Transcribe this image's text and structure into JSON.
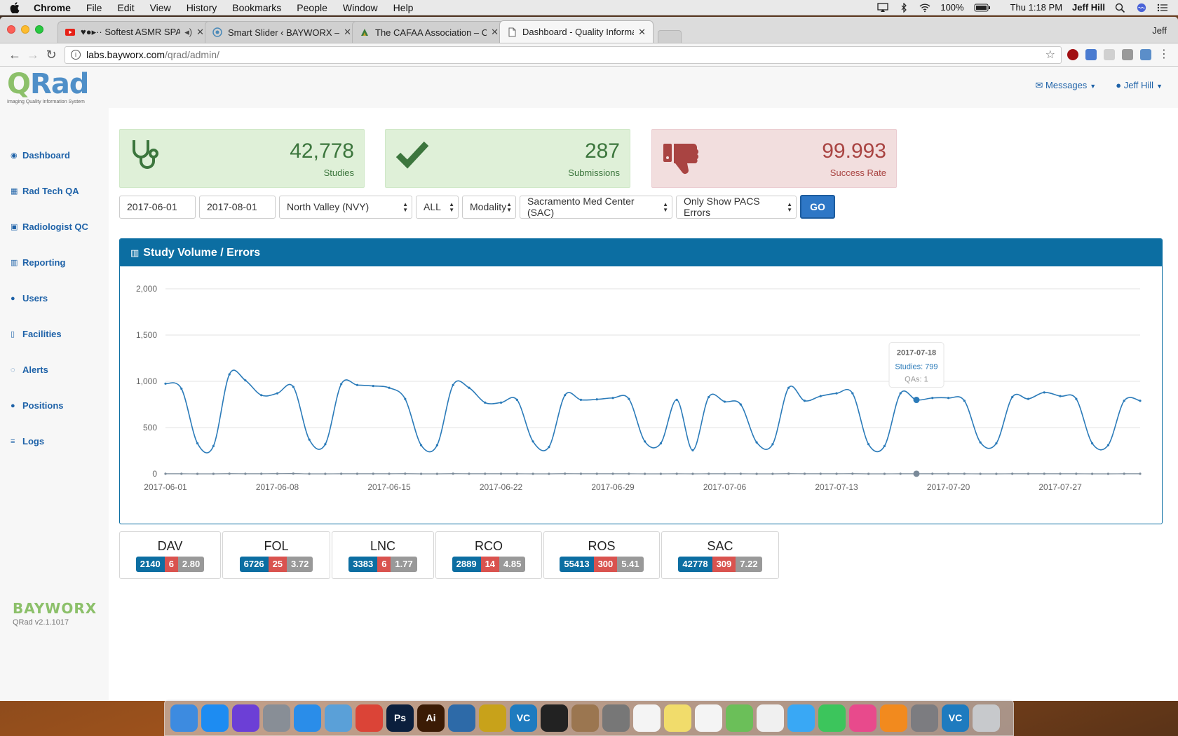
{
  "menubar": {
    "app": "Chrome",
    "items": [
      "File",
      "Edit",
      "View",
      "History",
      "Bookmarks",
      "People",
      "Window",
      "Help"
    ],
    "battery": "100%",
    "clock": "Thu 1:18 PM",
    "user": "Jeff Hill"
  },
  "browser": {
    "tabs": [
      {
        "title": "♥●▸·· Softest ASMR SPA 💤",
        "favicon": "youtube-icon"
      },
      {
        "title": "Smart Slider ‹ BAYWORX — WordPress",
        "favicon": "wordpress-icon"
      },
      {
        "title": "The CAFAA Association – California",
        "favicon": "site-icon"
      },
      {
        "title": "Dashboard - Quality Information System",
        "favicon": "page-icon"
      }
    ],
    "profile": "Jeff",
    "url_host": "labs.bayworx.com",
    "url_path": "/qrad/admin/"
  },
  "app": {
    "logo": "QRad",
    "tagline": "Imaging Quality Information System",
    "nav": [
      {
        "label": "Dashboard",
        "icon": "dashboard-icon",
        "glyph": "◉"
      },
      {
        "label": "Rad Tech QA",
        "icon": "table-icon",
        "glyph": "▦"
      },
      {
        "label": "Radiologist QC",
        "icon": "image-icon",
        "glyph": "▣"
      },
      {
        "label": "Reporting",
        "icon": "bar-chart-icon",
        "glyph": "▥"
      },
      {
        "label": "Users",
        "icon": "user-icon",
        "glyph": "●"
      },
      {
        "label": "Facilities",
        "icon": "clipboard-icon",
        "glyph": "▯"
      },
      {
        "label": "Alerts",
        "icon": "comment-icon",
        "glyph": "◌"
      },
      {
        "label": "Positions",
        "icon": "users-icon",
        "glyph": "●"
      },
      {
        "label": "Logs",
        "icon": "list-icon",
        "glyph": "≡"
      }
    ],
    "brand": "BAYWORX",
    "version": "QRad v2.1.1017",
    "messages_label": "Messages",
    "user_label": "Jeff Hill"
  },
  "stats": [
    {
      "value": "42,778",
      "label": "Studies",
      "icon": "stethoscope-icon"
    },
    {
      "value": "287",
      "label": "Submissions",
      "icon": "checkmark-icon"
    },
    {
      "value": "99.993",
      "label": "Success Rate",
      "icon": "thumbs-down-icon"
    }
  ],
  "filters": {
    "start_date": "2017-06-01",
    "end_date": "2017-08-01",
    "region": "North Valley (NVY)",
    "scope": "ALL",
    "modality": "Modality",
    "facility": "Sacramento Med Center (SAC)",
    "error_filter": "Only Show PACS Errors",
    "go_label": "GO"
  },
  "panel_title": "Study Volume / Errors",
  "chart_data": {
    "type": "line",
    "title": "Study Volume / Errors",
    "ylim": [
      0,
      2000
    ],
    "yticks": [
      "0",
      "500",
      "1,000",
      "1,500",
      "2,000"
    ],
    "xticks": [
      "2017-06-01",
      "2017-06-08",
      "2017-06-15",
      "2017-06-22",
      "2017-06-29",
      "2017-07-06",
      "2017-07-13",
      "2017-07-20",
      "2017-07-27"
    ],
    "x_start": "2017-06-01",
    "x_end": "2017-07-31",
    "grid": true,
    "series": [
      {
        "name": "Studies",
        "values": [
          975,
          920,
          330,
          300,
          1075,
          1010,
          850,
          870,
          940,
          370,
          320,
          970,
          960,
          950,
          930,
          810,
          310,
          310,
          960,
          930,
          770,
          770,
          800,
          350,
          290,
          850,
          800,
          805,
          820,
          810,
          350,
          330,
          800,
          255,
          830,
          780,
          750,
          340,
          320,
          930,
          790,
          840,
          870,
          870,
          320,
          300,
          870,
          799,
          820,
          820,
          790,
          340,
          330,
          830,
          810,
          880,
          840,
          810,
          330,
          310,
          790,
          790
        ]
      },
      {
        "name": "QAs",
        "values": [
          1,
          1,
          0,
          0,
          2,
          1,
          1,
          2,
          3,
          0,
          0,
          1,
          1,
          1,
          1,
          2,
          0,
          0,
          2,
          1,
          1,
          1,
          1,
          0,
          0,
          2,
          1,
          1,
          1,
          1,
          0,
          0,
          1,
          0,
          1,
          1,
          1,
          0,
          0,
          2,
          1,
          1,
          1,
          2,
          0,
          0,
          1,
          1,
          1,
          1,
          1,
          0,
          0,
          1,
          1,
          1,
          1,
          1,
          0,
          0,
          1,
          1
        ]
      }
    ],
    "tooltip": {
      "date": "2017-07-18",
      "studies": "Studies: 799",
      "qas": "QAs: 1",
      "index": 47
    },
    "colors": {
      "studies": "#2b7bb9",
      "qas": "#7a8a99"
    }
  },
  "facilities": [
    {
      "code": "DAV",
      "total": "2140",
      "errors": "6",
      "rate": "2.80"
    },
    {
      "code": "FOL",
      "total": "6726",
      "errors": "25",
      "rate": "3.72"
    },
    {
      "code": "LNC",
      "total": "3383",
      "errors": "6",
      "rate": "1.77"
    },
    {
      "code": "RCO",
      "total": "2889",
      "errors": "14",
      "rate": "4.85"
    },
    {
      "code": "ROS",
      "total": "55413",
      "errors": "300",
      "rate": "5.41"
    },
    {
      "code": "SAC",
      "total": "42778",
      "errors": "309",
      "rate": "7.22"
    }
  ],
  "dock": [
    {
      "name": "finder-icon",
      "color": "#3d8be0"
    },
    {
      "name": "app-store-icon",
      "color": "#1d8cf2"
    },
    {
      "name": "siri-icon",
      "color": "#6c3fd6"
    },
    {
      "name": "launchpad-icon",
      "color": "#888e96"
    },
    {
      "name": "safari-icon",
      "color": "#2a8de9"
    },
    {
      "name": "preview-icon",
      "color": "#5aa0d8"
    },
    {
      "name": "chrome-icon",
      "color": "#db4437"
    },
    {
      "name": "photoshop-icon",
      "color": "#0b1f3d",
      "text": "Ps"
    },
    {
      "name": "illustrator-icon",
      "color": "#3b1b05",
      "text": "Ai"
    },
    {
      "name": "virtualbox-icon",
      "color": "#2d6aa8"
    },
    {
      "name": "filezilla-icon",
      "color": "#c8a21a"
    },
    {
      "name": "vscode-icon",
      "color": "#1e7bbf",
      "text": "VC"
    },
    {
      "name": "terminal-icon",
      "color": "#222"
    },
    {
      "name": "archive-icon",
      "color": "#9b7650"
    },
    {
      "name": "calculator-icon",
      "color": "#777"
    },
    {
      "name": "calendar-icon",
      "color": "#f4f4f4"
    },
    {
      "name": "notes-icon",
      "color": "#f1dc6b"
    },
    {
      "name": "reminders-icon",
      "color": "#f4f4f4"
    },
    {
      "name": "maps-icon",
      "color": "#6bbf59"
    },
    {
      "name": "photos-icon",
      "color": "#f0f0f0"
    },
    {
      "name": "messages-icon",
      "color": "#39a8f5"
    },
    {
      "name": "facetime-icon",
      "color": "#3cc55c"
    },
    {
      "name": "itunes-icon",
      "color": "#e84a8c"
    },
    {
      "name": "ibooks-icon",
      "color": "#f28a1e"
    },
    {
      "name": "system-preferences-icon",
      "color": "#7c7c80"
    },
    {
      "name": "vnc-icon",
      "color": "#1e7bbf",
      "text": "VC"
    },
    {
      "name": "trash-icon",
      "color": "#c7c9cc"
    }
  ]
}
